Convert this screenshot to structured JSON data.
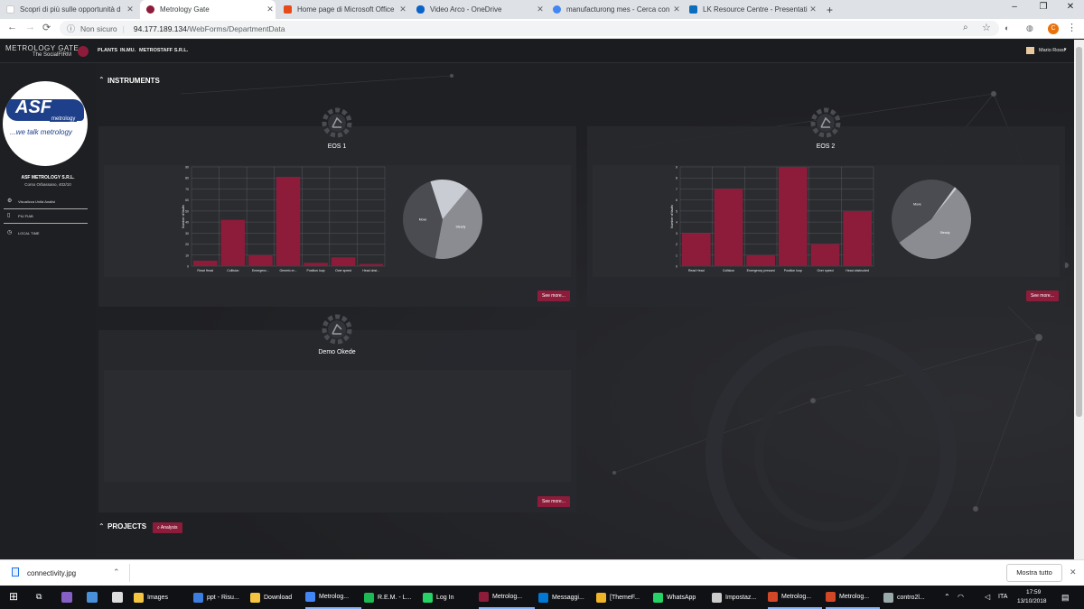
{
  "browser": {
    "tabs": [
      {
        "title": "Scopri di più sulle opportunità d",
        "fav": "#ffffff"
      },
      {
        "title": "Metrology Gate",
        "fav": "#8c1c3a",
        "active": true
      },
      {
        "title": "Home page di Microsoft Office",
        "fav": "#e64a19"
      },
      {
        "title": "Video Arco - OneDrive",
        "fav": "#0a64c8"
      },
      {
        "title": "manufacturong mes - Cerca con",
        "fav": "#4285f4"
      },
      {
        "title": "LK Resource Centre - Presentati",
        "fav": "#0a6ebd"
      }
    ],
    "new_tab": "+",
    "not_secure": "Non sicuro",
    "url_host": "94.177.189.134",
    "url_path": "/WebForms/DepartmentData",
    "profile_initial": "C"
  },
  "app": {
    "brand_line1": "METROLOGY GATE",
    "brand_line2": "The SocialFIRM",
    "nav": [
      "PLANTS",
      "IN.MU.",
      "METROSTAFF S.R.L."
    ],
    "user": "Mario Rossi",
    "logo_text": "ASF",
    "logo_sub": "metrology",
    "logo_tagline": "...we talk metrology",
    "company_name": "ASF METROLOGY S.R.L.",
    "company_addr": "Corso Orbassano, 402/10",
    "menu": [
      "Visualizza Unità Analisi",
      "PIU FIAB",
      "LOCAL TIME"
    ],
    "instruments_header": "INSTRUMENTS",
    "projects_header": "PROJECTS",
    "analysis_btn": "Analysis",
    "see_more": "See more...",
    "instruments": [
      {
        "name": "EOS 1"
      },
      {
        "name": "EOS 2"
      },
      {
        "name": "Demo Okede"
      }
    ]
  },
  "chart_data": [
    {
      "type": "bar",
      "title": "",
      "ylabel": "Number of faults",
      "categories": [
        "Read Head",
        "Collision",
        "Emergenc...",
        "Generic er...",
        "Position loop",
        "Over speed",
        "Head obst..."
      ],
      "values": [
        5,
        42,
        10,
        81,
        3,
        8,
        2
      ],
      "ylim": [
        0,
        90
      ],
      "yticks": [
        0,
        10,
        20,
        30,
        40,
        50,
        60,
        70,
        80,
        90
      ],
      "color": "#8c1c3a"
    },
    {
      "type": "pie",
      "labels": [
        "Steady",
        "Move",
        ""
      ],
      "values": [
        42,
        42,
        16
      ],
      "colors": [
        "#8a8c91",
        "#4a4c52",
        "#c9ccd3"
      ]
    },
    {
      "type": "bar",
      "title": "",
      "ylabel": "Number of faults",
      "categories": [
        "Read Head",
        "Collision",
        "Emergency pressed",
        "Position loop",
        "Over speed",
        "Head obstructed"
      ],
      "values": [
        3,
        7,
        1,
        9,
        2,
        5
      ],
      "ylim": [
        0,
        9
      ],
      "yticks": [
        0,
        1,
        2,
        3,
        4,
        5,
        6,
        7,
        8,
        9
      ],
      "color": "#8c1c3a"
    },
    {
      "type": "pie",
      "labels": [
        "Steady",
        "Move",
        ""
      ],
      "values": [
        54,
        45,
        1
      ],
      "colors": [
        "#8a8c91",
        "#4a4c52",
        "#c9ccd3"
      ]
    }
  ],
  "download_bar": {
    "file": "connectivity.jpg",
    "show_all": "Mostra tutto"
  },
  "taskbar": {
    "items": [
      "Images",
      "ppt - Risu...",
      "Download",
      "Metrolog...",
      "R.E.M. - L...",
      "Log In",
      "Metrolog...",
      "Messaggi...",
      "[ThemeF...",
      "WhatsApp",
      "Impostaz...",
      "Metrolog...",
      "Metrolog...",
      "contro2l..."
    ],
    "lang": "ITA",
    "time": "17:59",
    "date": "13/10/2018"
  }
}
